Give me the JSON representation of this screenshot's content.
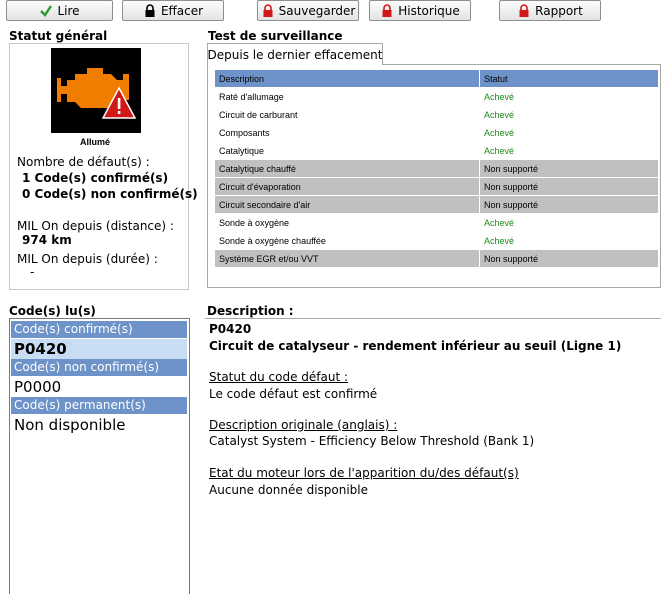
{
  "toolbar": {
    "read": "Lire",
    "clear": "Effacer",
    "save": "Sauvegarder",
    "history": "Historique",
    "report": "Rapport"
  },
  "status": {
    "heading": "Statut général",
    "mil_state": "Allumé",
    "fault_count_label": "Nombre de défaut(s) :",
    "confirmed_count": "1 Code(s) confirmé(s)",
    "unconfirmed_count": "0 Code(s) non confirmé(s)",
    "mil_distance_label": "MIL On depuis (distance) :",
    "mil_distance_value": "974 km",
    "mil_duration_label": "MIL On depuis (durée) :",
    "mil_duration_value": "-"
  },
  "monitor": {
    "heading": "Test de surveillance",
    "tab": "Depuis le dernier effacement",
    "col_description": "Description",
    "col_status": "Statut",
    "rows": [
      {
        "description": "Raté d'allumage",
        "status": "Achevé",
        "supported": true
      },
      {
        "description": "Circuit de carburant",
        "status": "Achevé",
        "supported": true
      },
      {
        "description": "Composants",
        "status": "Achevé",
        "supported": true
      },
      {
        "description": "Catalytique",
        "status": "Achevé",
        "supported": true
      },
      {
        "description": "Catalytique chauffé",
        "status": "Non supporté",
        "supported": false
      },
      {
        "description": "Circuit d'évaporation",
        "status": "Non supporté",
        "supported": false
      },
      {
        "description": "Circuit secondaire d'air",
        "status": "Non supporté",
        "supported": false
      },
      {
        "description": "Sonde à oxygène",
        "status": "Achevé",
        "supported": true
      },
      {
        "description": "Sonde à oxygène chauffée",
        "status": "Achevé",
        "supported": true
      },
      {
        "description": "Système EGR et/ou VVT",
        "status": "Non supporté",
        "supported": false
      }
    ]
  },
  "codes": {
    "heading": "Code(s) lu(s)",
    "confirmed_header": "Code(s) confirmé(s)",
    "confirmed_code": "P0420",
    "unconfirmed_header": "Code(s) non confirmé(s)",
    "unconfirmed_code": "P0000",
    "permanent_header": "Code(s) permanent(s)",
    "permanent_value": "Non disponible"
  },
  "description": {
    "heading": "Description :",
    "code": "P0420",
    "title": "Circuit de catalyseur - rendement inférieur au seuil (Ligne 1)",
    "status_label": "Statut du code défaut :",
    "status_value": "Le code défaut est confirmé",
    "original_label": "Description originale (anglais) :",
    "original_value": "Catalyst System - Efficiency Below Threshold (Bank 1)",
    "engine_state_label": "Etat du moteur lors de l'apparition du/des défaut(s)",
    "engine_state_value": "Aucune donnée disponible"
  },
  "colors": {
    "header_blue": "#6d93c8",
    "ok_green": "#1e8a1e",
    "unsupported_gray": "#c0c0c0",
    "lock_red": "#d01818",
    "engine_orange": "#f07d00"
  },
  "icons": {
    "read": "check-icon",
    "clear": "lock-icon",
    "save": "lock-icon",
    "history": "lock-icon",
    "report": "lock-icon",
    "mil": "check-engine-warning-icon"
  }
}
